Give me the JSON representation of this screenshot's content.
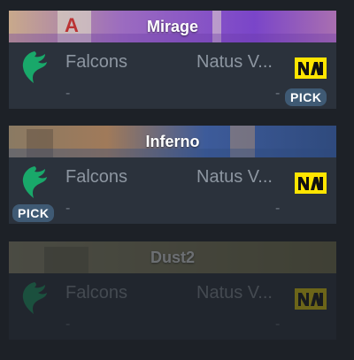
{
  "maps": [
    {
      "map_name": "Mirage",
      "team_left": "Falcons",
      "team_right": "Natus V...",
      "score_left": "-",
      "score_right": "-",
      "pick": "PICK",
      "pick_side": "right",
      "dimmed": false,
      "header_colors": [
        "#c7a98c",
        "#7a45c9"
      ]
    },
    {
      "map_name": "Inferno",
      "team_left": "Falcons",
      "team_right": "Natus V...",
      "score_left": "-",
      "score_right": "-",
      "pick": "PICK",
      "pick_side": "left",
      "dimmed": false,
      "header_colors": [
        "#8a7a63",
        "#3d5b9a"
      ]
    },
    {
      "map_name": "Dust2",
      "team_left": "Falcons",
      "team_right": "Natus V...",
      "score_left": "-",
      "score_right": "-",
      "pick": "",
      "pick_side": "none",
      "dimmed": true,
      "header_colors": [
        "#8f8a63",
        "#7f7a4e"
      ]
    }
  ],
  "colors": {
    "page_bg": "#1d2127",
    "card_bg": "#2b323c",
    "team_text": "#8d96a1",
    "pick_badge": "#3f5a74",
    "falcons_green": "#19a86a",
    "navi_yellow": "#ffe500"
  },
  "icons": {
    "left_team_logo": "falcons-logo-icon",
    "right_team_logo": "navi-logo-icon"
  }
}
